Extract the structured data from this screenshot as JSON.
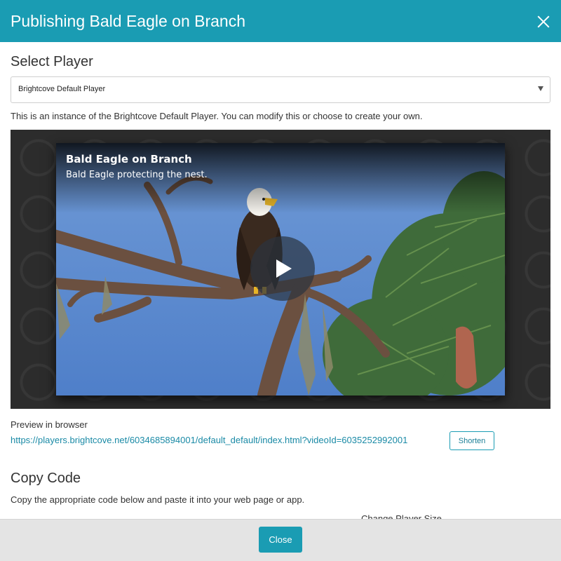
{
  "dialog": {
    "title": "Publishing Bald Eagle on Branch"
  },
  "select_player": {
    "heading": "Select Player",
    "selected_value": "Brightcove Default Player",
    "info": "This is an instance of the Brightcove Default Player. You can modify this or choose to create your own."
  },
  "video": {
    "title": "Bald Eagle on Branch",
    "description": "Bald Eagle protecting the nest."
  },
  "preview": {
    "label": "Preview in browser",
    "url": "https://players.brightcove.net/6034685894001/default_default/index.html?videoId=6035252992001",
    "shorten_label": "Shorten"
  },
  "copy_code": {
    "heading": "Copy Code",
    "instructions": "Copy the appropriate code below and paste it into your web page or app.",
    "change_size_label": "Change Player Size"
  },
  "footer": {
    "close_label": "Close"
  },
  "colors": {
    "accent": "#1a9cb3",
    "link": "#1a8aa6",
    "footer_bg": "#e4e4e4"
  },
  "icons": [
    "close-icon",
    "dropdown-arrow-icon",
    "play-icon"
  ]
}
